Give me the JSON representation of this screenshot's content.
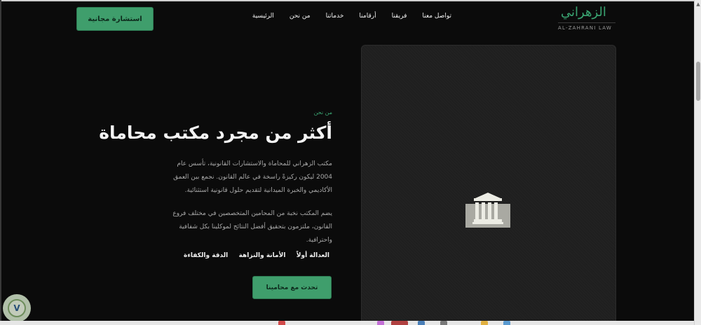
{
  "brand": {
    "name_ar": "الزهراني",
    "name_en": "AL-ZAHRANI LAW",
    "accent_color": "#3aa572"
  },
  "nav": {
    "items": [
      {
        "label": "الرئيسية"
      },
      {
        "label": "من نحن"
      },
      {
        "label": "خدماتنا"
      },
      {
        "label": "أرقامنا"
      },
      {
        "label": "فريقنا"
      },
      {
        "label": "تواصل معنا"
      }
    ]
  },
  "header": {
    "cta_label": "استشارة مجانية"
  },
  "about": {
    "eyebrow": "من نحن",
    "title": "أكثر من مجرد مكتب محاماة",
    "paragraph1": "مكتب الزهراني للمحاماة والاستشارات القانونية، تأسس عام 2004 ليكون ركيزةً راسخة في عالم القانون. نجمع بين العمق الأكاديمي والخبرة الميدانية لتقديم حلول قانونية استثنائية.",
    "paragraph2": "يضم المكتب نخبة من المحامين المتخصصين في مختلف فروع القانون، ملتزمون بتحقيق أفضل النتائج لموكلينا بكل شفافية واحترافية.",
    "values": [
      {
        "label": "العدالة أولاً"
      },
      {
        "label": "الأمانة والنزاهة"
      },
      {
        "label": "الدقة والكفاءة"
      }
    ],
    "cta_label": "تحدث مع محامينا",
    "image_icon": "courthouse-icon"
  },
  "floating_badge": {
    "icon": "shield-v-icon",
    "letter": "V"
  }
}
